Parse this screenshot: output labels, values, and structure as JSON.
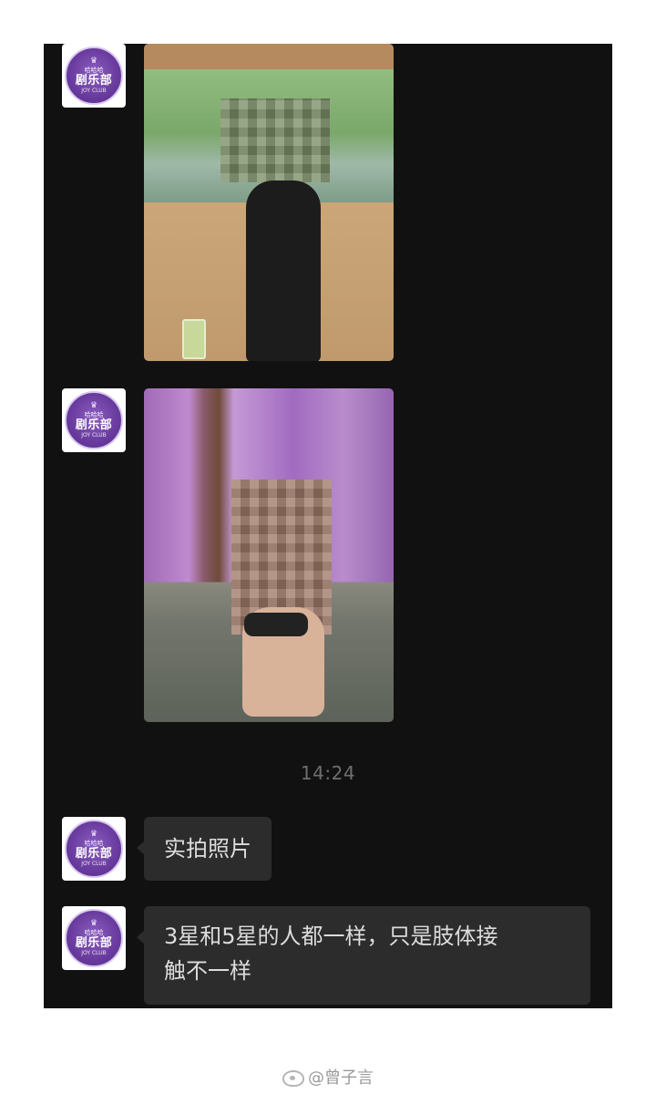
{
  "avatar": {
    "top_text": "哈哈哈",
    "main_text": "剧乐部",
    "sub_text": "JOY CLUB",
    "crown_icon": "crown-icon"
  },
  "messages": [
    {
      "type": "image",
      "sender": "avatar",
      "description_icon": "photo-icon"
    },
    {
      "type": "image",
      "sender": "avatar",
      "description_icon": "photo-icon"
    },
    {
      "type": "time",
      "text": "14:24"
    },
    {
      "type": "text",
      "sender": "avatar",
      "text": "实拍照片"
    },
    {
      "type": "text",
      "sender": "avatar",
      "text_line1": "3星和5星的人都一样，只是肢体接",
      "text_line2": "触不一样"
    }
  ],
  "watermark": {
    "text": "@曾子言",
    "icon": "weibo-icon"
  },
  "colors": {
    "chat_background": "#111111",
    "bubble_background": "#2c2c2c",
    "bubble_text": "#dcdcdc",
    "time_text": "#6f6f6f",
    "avatar_purple": "#6b3da0"
  }
}
